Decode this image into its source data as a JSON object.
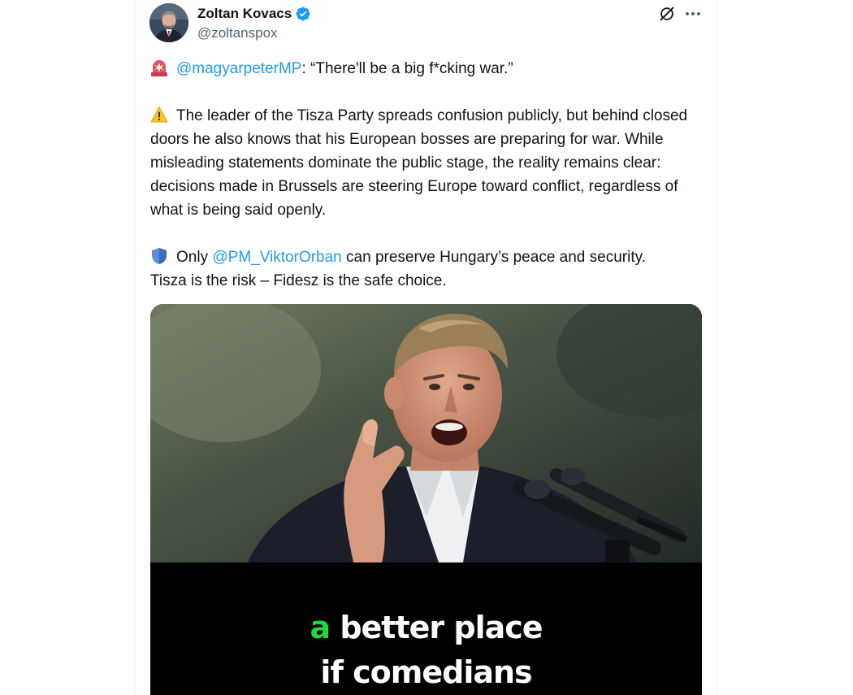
{
  "author": {
    "name": "Zoltan Kovacs",
    "handle": "@zoltanspox",
    "verified": true,
    "icons": [
      "verified-badge-icon",
      "grok-icon",
      "more-options-icon"
    ]
  },
  "tweet": {
    "paragraph1": {
      "emoji": "rotating-light-emoji",
      "mention": "@magyarpeterMP",
      "text": ": “There'll be a big f*cking war.”"
    },
    "paragraph2": {
      "emoji": "warning-emoji",
      "text": "The leader of the Tisza Party spreads confusion publicly, but behind closed doors he also knows that his European bosses are preparing for war. While misleading statements dominate the public stage, the reality remains clear: decisions made in Brussels are steering Europe toward conflict, regardless of what is being said openly."
    },
    "paragraph3": {
      "emoji": "shield-emoji",
      "prefix": "Only",
      "mention": "@PM_ViktorOrban",
      "suffix": "can preserve Hungary’s peace and security.",
      "line2": "Tisza is the risk – Fidesz is the safe choice."
    }
  },
  "media": {
    "caption_accent": "a",
    "caption_line1_rest": "better place",
    "caption_line2": "if comedians"
  },
  "colors": {
    "link": "#1d9bf0",
    "text": "#0f1419",
    "secondary": "#536471",
    "verified": "#1d9bf0",
    "caption_accent": "#23d63a"
  }
}
